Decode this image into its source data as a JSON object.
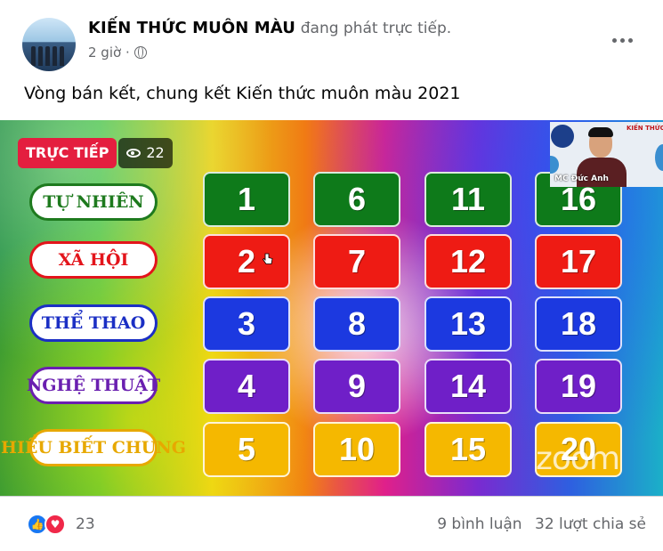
{
  "post": {
    "author": "KIẾN THỨC MUÔN MÀU",
    "action": "đang phát trực tiếp.",
    "time": "2 giờ ·",
    "caption": "Vòng bán kết, chung kết Kiến thức muôn màu 2021"
  },
  "video": {
    "live_label": "TRỰC TIẾP",
    "viewers": "22",
    "webcam_brand": "KIẾN THỨC MUÔN MÀU",
    "webcam_name": "MC Đức Anh",
    "watermark": "zoom",
    "categories": [
      {
        "label": "TỰ NHIÊN",
        "color": "#1e7a1e"
      },
      {
        "label": "XÃ HỘI",
        "color": "#e3141b"
      },
      {
        "label": "THỂ THAO",
        "color": "#1b2fc4"
      },
      {
        "label": "NGHỆ THUẬT",
        "color": "#6a1fb0"
      },
      {
        "label": "HIỂU BIẾT CHUNG",
        "color": "#e7a800"
      }
    ],
    "rows": [
      {
        "color": "#0e7a1a",
        "numbers": [
          "1",
          "6",
          "11",
          "16"
        ]
      },
      {
        "color": "#ee1b14",
        "numbers": [
          "2",
          "7",
          "12",
          "17"
        ]
      },
      {
        "color": "#1c39e0",
        "numbers": [
          "3",
          "8",
          "13",
          "18"
        ]
      },
      {
        "color": "#6f1fc8",
        "numbers": [
          "4",
          "9",
          "14",
          "19"
        ]
      },
      {
        "color": "#f5b800",
        "numbers": [
          "5",
          "10",
          "15",
          "20"
        ]
      }
    ]
  },
  "footer": {
    "reaction_count": "23",
    "comments": "9 bình luận",
    "shares": "32 lượt chia sẻ"
  }
}
